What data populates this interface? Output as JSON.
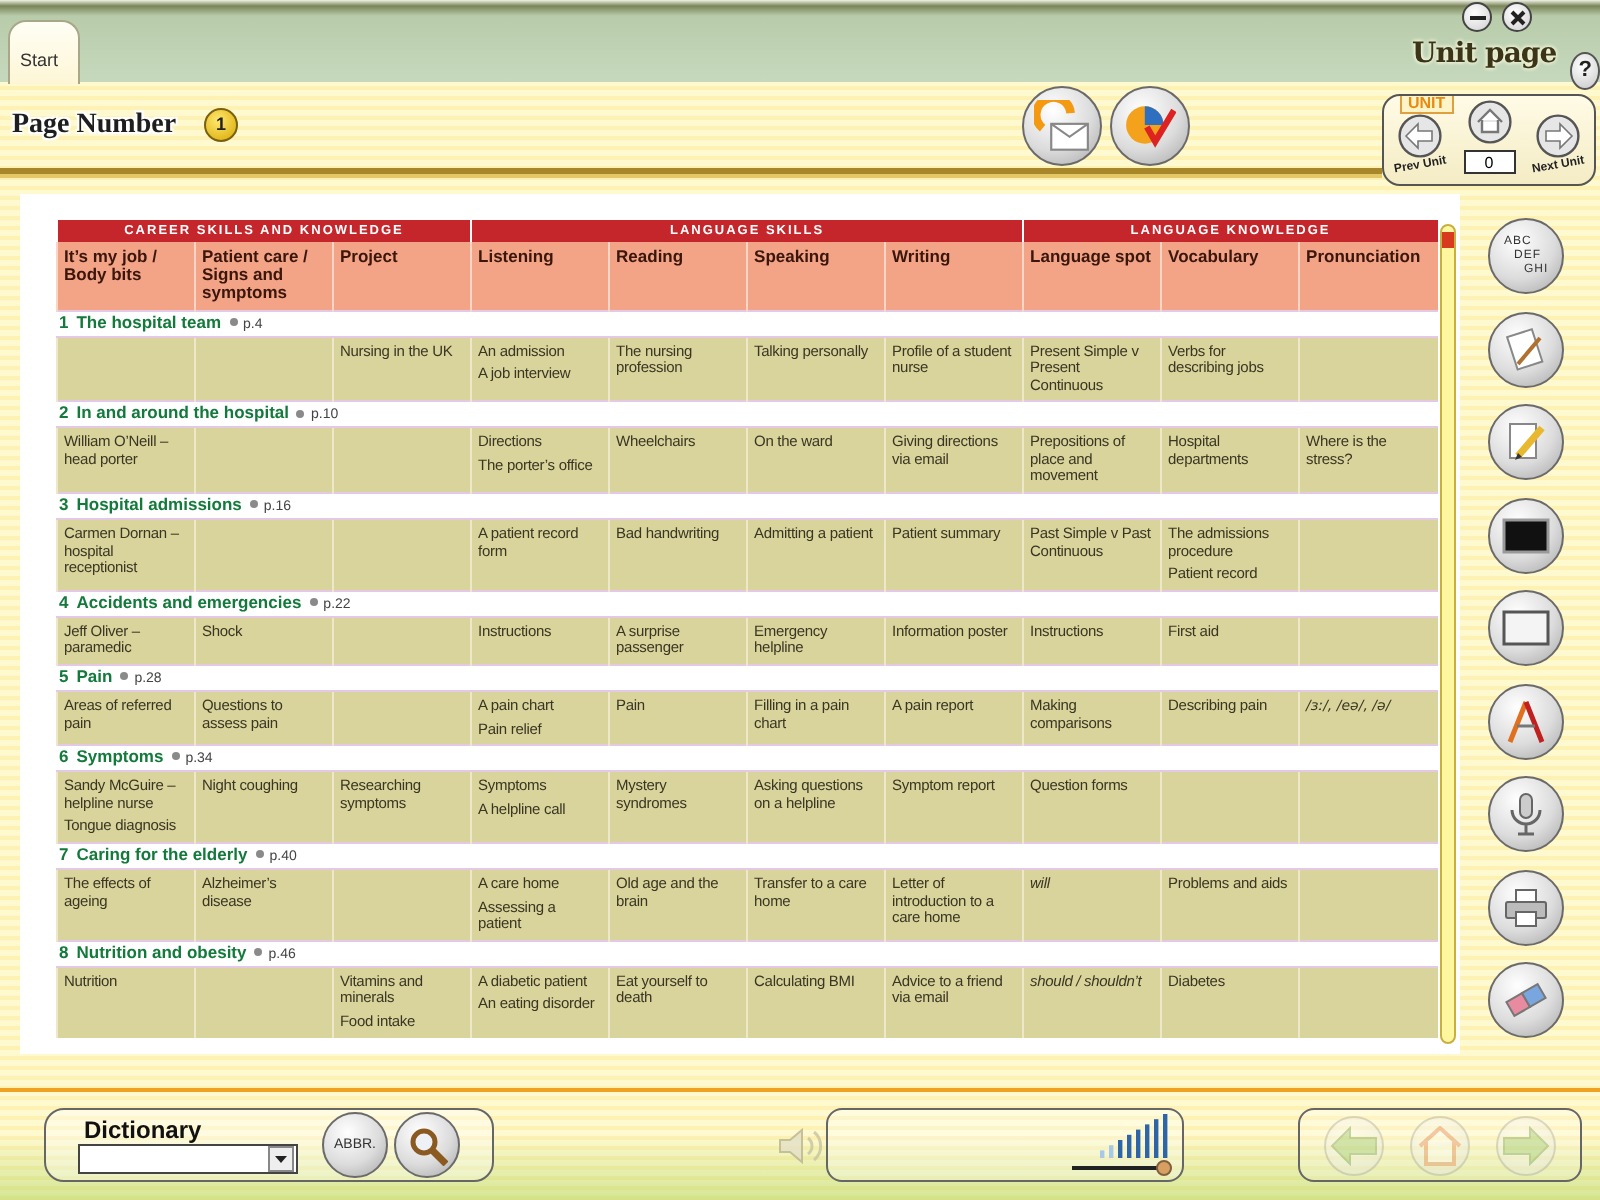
{
  "window": {
    "tab": "Start",
    "title": "Unit page",
    "help": "?"
  },
  "header": {
    "page_number_label": "Page Number",
    "page_number": "1",
    "unit_nav": {
      "label": "UNIT",
      "prev": "Prev Unit",
      "value": "0",
      "next": "Next Unit"
    }
  },
  "table": {
    "groups": [
      {
        "label": "CAREER SKILLS AND KNOWLEDGE",
        "columns": [
          "It’s my job / Body bits",
          "Patient care / Signs and symptoms",
          "Project"
        ]
      },
      {
        "label": "LANGUAGE SKILLS",
        "columns": [
          "Listening",
          "Reading",
          "Speaking",
          "Writing"
        ]
      },
      {
        "label": "LANGUAGE KNOWLEDGE",
        "columns": [
          "Language spot",
          "Vocabulary",
          "Pronunciation"
        ]
      }
    ],
    "units": [
      {
        "number": "1",
        "title": "The hospital team",
        "page": "p.4",
        "cells": [
          null,
          null,
          [
            "Nursing in the UK"
          ],
          [
            "An admission",
            "A job interview"
          ],
          [
            "The nursing profession"
          ],
          [
            "Talking personally"
          ],
          [
            "Profile of a student nurse"
          ],
          [
            "Present Simple v Present Continuous"
          ],
          [
            "Verbs for describing jobs"
          ],
          null
        ]
      },
      {
        "number": "2",
        "title": "In and around the hospital",
        "page": "p.10",
        "cells": [
          [
            "William O’Neill – head porter"
          ],
          null,
          null,
          [
            "Directions",
            "The porter’s office"
          ],
          [
            "Wheelchairs"
          ],
          [
            "On the ward"
          ],
          [
            "Giving directions via email"
          ],
          [
            "Prepositions of place and movement"
          ],
          [
            "Hospital departments"
          ],
          [
            "Where is the stress?"
          ]
        ]
      },
      {
        "number": "3",
        "title": "Hospital admissions",
        "page": "p.16",
        "cells": [
          [
            "Carmen Dornan – hospital receptionist"
          ],
          null,
          null,
          [
            "A patient record form"
          ],
          [
            "Bad handwriting"
          ],
          [
            "Admitting a patient"
          ],
          [
            "Patient summary"
          ],
          [
            "Past Simple v Past Continuous"
          ],
          [
            "The admissions procedure",
            "Patient record"
          ],
          null
        ]
      },
      {
        "number": "4",
        "title": "Accidents and emergencies",
        "page": "p.22",
        "cells": [
          [
            "Jeff Oliver – paramedic"
          ],
          [
            "Shock"
          ],
          null,
          [
            "Instructions"
          ],
          [
            "A surprise passenger"
          ],
          [
            "Emergency helpline"
          ],
          [
            "Information poster"
          ],
          [
            "Instructions"
          ],
          [
            "First aid"
          ],
          null
        ]
      },
      {
        "number": "5",
        "title": "Pain",
        "page": "p.28",
        "cells": [
          [
            "Areas of referred pain"
          ],
          [
            "Questions to assess pain"
          ],
          null,
          [
            "A pain chart",
            "Pain relief"
          ],
          [
            "Pain"
          ],
          [
            "Filling in a pain chart"
          ],
          [
            "A pain report"
          ],
          [
            "Making comparisons"
          ],
          [
            "Describing pain"
          ],
          {
            "kind": "phonetic",
            "lines": [
              "/ɜː/, /eə/, /ə/"
            ]
          }
        ]
      },
      {
        "number": "6",
        "title": "Symptoms",
        "page": "p.34",
        "cells": [
          [
            "Sandy McGuire – helpline nurse",
            "Tongue diagnosis"
          ],
          [
            "Night coughing"
          ],
          [
            "Researching symptoms"
          ],
          [
            "Symptoms",
            "A helpline call"
          ],
          [
            "Mystery syndromes"
          ],
          [
            "Asking questions on a helpline"
          ],
          [
            "Symptom report"
          ],
          [
            "Question forms"
          ],
          null,
          null
        ]
      },
      {
        "number": "7",
        "title": "Caring for the elderly",
        "page": "p.40",
        "cells": [
          [
            "The effects of ageing"
          ],
          [
            "Alzheimer’s disease"
          ],
          null,
          [
            "A care home",
            "Assessing a patient"
          ],
          [
            "Old age and the brain"
          ],
          [
            "Transfer to a care home"
          ],
          [
            "Letter of introduction to a care home"
          ],
          {
            "kind": "grammar",
            "lines": [
              "will"
            ]
          },
          [
            "Problems and aids"
          ],
          null
        ]
      },
      {
        "number": "8",
        "title": "Nutrition and obesity",
        "page": "p.46",
        "cells": [
          [
            "Nutrition"
          ],
          null,
          [
            "Vitamins and minerals",
            "Food intake"
          ],
          [
            "A diabetic patient",
            "An eating disorder"
          ],
          [
            "Eat yourself to death"
          ],
          [
            "Calculating BMI"
          ],
          [
            "Advice to a friend via email"
          ],
          {
            "kind": "grammar",
            "lines": [
              "should / shouldn’t"
            ]
          },
          [
            "Diabetes"
          ],
          null
        ]
      }
    ]
  },
  "toolbar": {
    "alphabet_letters": [
      "ABC",
      "DEF",
      "GHI"
    ]
  },
  "footer": {
    "dictionary_label": "Dictionary",
    "abbr_button": "ABBR.",
    "volume": {
      "level": 0.92
    },
    "nav_buttons": [
      {
        "kind": "back",
        "disabled": true
      },
      {
        "kind": "home",
        "disabled": true
      },
      {
        "kind": "forward",
        "disabled": true
      }
    ]
  }
}
